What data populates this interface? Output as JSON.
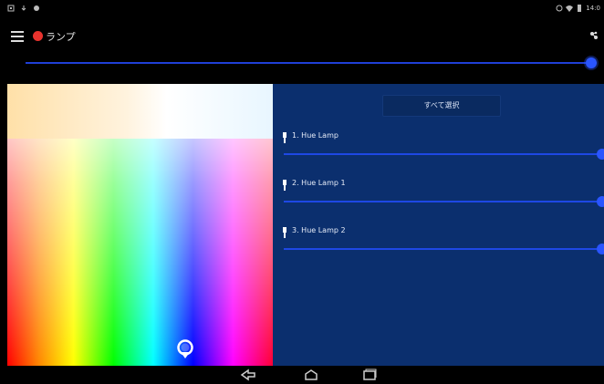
{
  "status_bar": {
    "time": "14:0",
    "left_icons": [
      "notification-icon",
      "download-icon",
      "sync-icon"
    ],
    "right_icons": [
      "alarm-icon",
      "wifi-icon",
      "battery-icon"
    ]
  },
  "app_bar": {
    "title": "ランプ",
    "brand_color": "#e8332e",
    "menu_icon": "hamburger-icon",
    "action_icon": "bridge-connect-icon"
  },
  "master_slider": {
    "value": 1.0,
    "color": "#1f3fd6"
  },
  "color_picker": {
    "handle_icon": "location-pin-icon"
  },
  "lamp_panel": {
    "background": "#0b2f6e",
    "all_button_label": "すべて選択",
    "lamps": [
      {
        "label": "1. Hue Lamp",
        "brightness": 1.0
      },
      {
        "label": "2. Hue Lamp 1",
        "brightness": 1.0
      },
      {
        "label": "3. Hue Lamp 2",
        "brightness": 1.0
      }
    ]
  },
  "nav_bar": {
    "buttons": [
      "back-icon",
      "home-icon",
      "recents-icon"
    ]
  }
}
